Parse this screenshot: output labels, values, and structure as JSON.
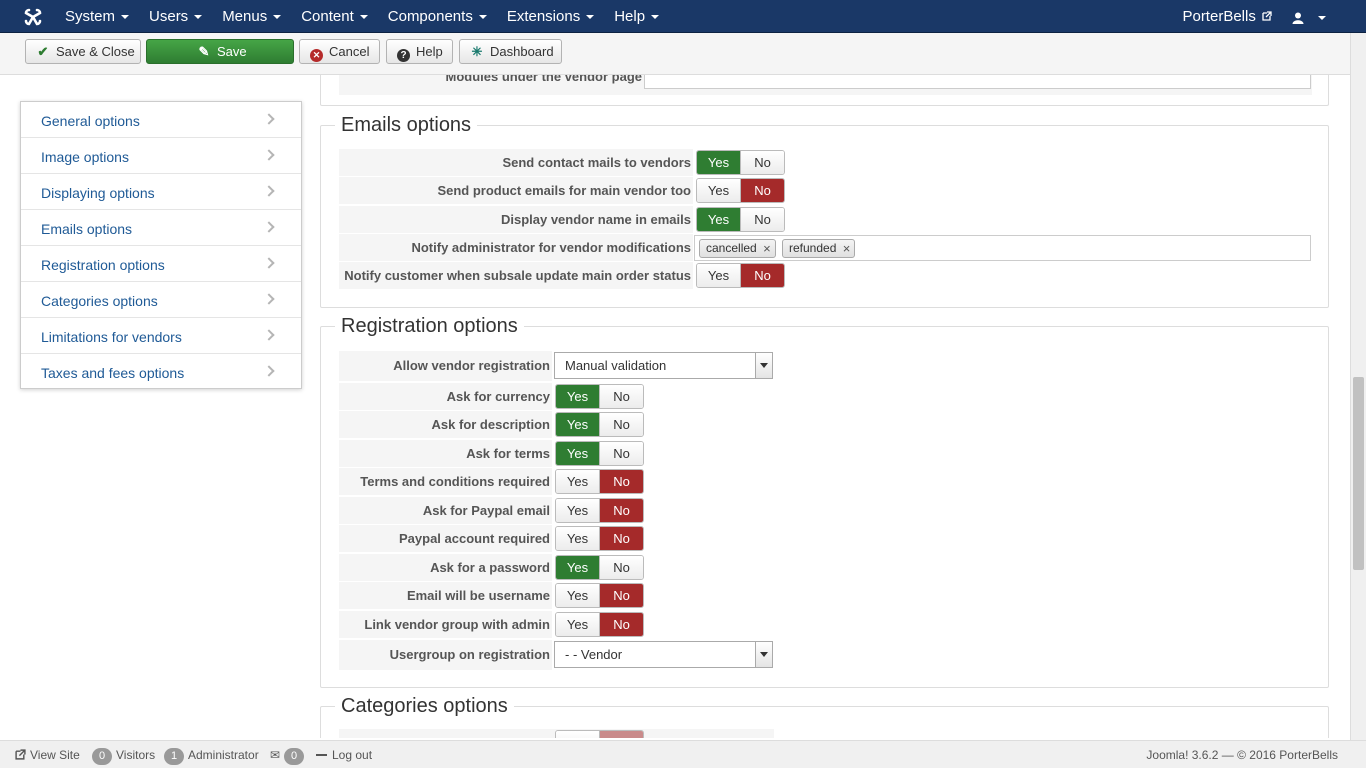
{
  "topbar": {
    "menus": [
      "System",
      "Users",
      "Menus",
      "Content",
      "Components",
      "Extensions",
      "Help"
    ],
    "site_name": "PorterBells"
  },
  "toolbar": {
    "save_close": "Save & Close",
    "save": "Save",
    "cancel": "Cancel",
    "help": "Help",
    "dashboard": "Dashboard"
  },
  "top_partial": {
    "label": "Modules under the vendor page"
  },
  "sidebar": {
    "items": [
      "General options",
      "Image options",
      "Displaying options",
      "Emails options",
      "Registration options",
      "Categories options",
      "Limitations for vendors",
      "Taxes and fees options"
    ]
  },
  "emails": {
    "title": "Emails options",
    "fields": [
      {
        "label": "Send contact mails to vendors",
        "yes": "Yes",
        "no": "No",
        "value": "yes"
      },
      {
        "label": "Send product emails for main vendor too",
        "yes": "Yes",
        "no": "No",
        "value": "no"
      },
      {
        "label": "Display vendor name in emails",
        "yes": "Yes",
        "no": "No",
        "value": "yes"
      },
      {
        "label": "Notify administrator for vendor modifications",
        "tags": [
          "cancelled",
          "refunded"
        ]
      },
      {
        "label": "Notify customer when subsale update main order status",
        "yes": "Yes",
        "no": "No",
        "value": "no"
      }
    ]
  },
  "registration": {
    "title": "Registration options",
    "allow": {
      "label": "Allow vendor registration",
      "value": "Manual validation"
    },
    "fields": [
      {
        "label": "Ask for currency",
        "yes": "Yes",
        "no": "No",
        "value": "yes"
      },
      {
        "label": "Ask for description",
        "yes": "Yes",
        "no": "No",
        "value": "yes"
      },
      {
        "label": "Ask for terms",
        "yes": "Yes",
        "no": "No",
        "value": "yes"
      },
      {
        "label": "Terms and conditions required",
        "yes": "Yes",
        "no": "No",
        "value": "no"
      },
      {
        "label": "Ask for Paypal email",
        "yes": "Yes",
        "no": "No",
        "value": "no"
      },
      {
        "label": "Paypal account required",
        "yes": "Yes",
        "no": "No",
        "value": "no"
      },
      {
        "label": "Ask for a password",
        "yes": "Yes",
        "no": "No",
        "value": "yes"
      },
      {
        "label": "Email will be username",
        "yes": "Yes",
        "no": "No",
        "value": "no"
      },
      {
        "label": "Link vendor group with admin",
        "yes": "Yes",
        "no": "No",
        "value": "no"
      }
    ],
    "usergroup": {
      "label": "Usergroup on registration",
      "value": "- - Vendor"
    }
  },
  "categories": {
    "title": "Categories options"
  },
  "footer": {
    "view_site": "View Site",
    "visitors_count": "0",
    "visitors": "Visitors",
    "admin_count": "1",
    "admin": "Administrator",
    "messages_count": "0",
    "logout": "Log out",
    "version": "Joomla! 3.6.2 — © 2016 PorterBells"
  },
  "colors": {
    "navbar": "#1a3867",
    "yes_active": "#2f7d32",
    "no_active": "#a52a2a",
    "link": "#1f5a96"
  }
}
